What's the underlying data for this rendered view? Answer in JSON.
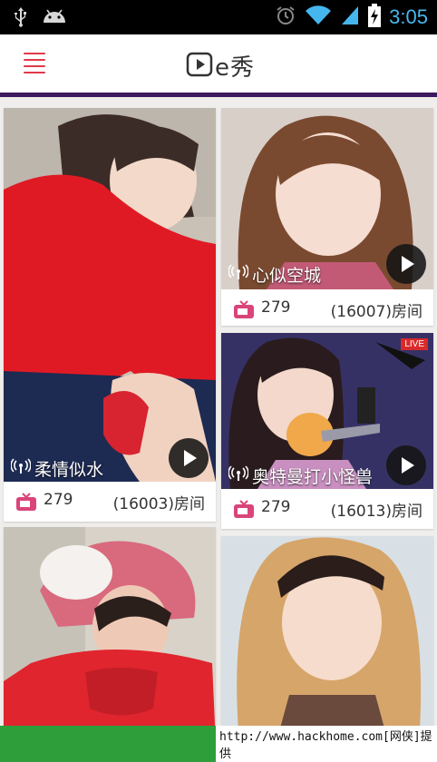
{
  "status_bar": {
    "time": "3:05",
    "icons": [
      "usb-icon",
      "android-icon",
      "alarm-icon",
      "wifi-icon",
      "signal-icon",
      "battery-charging-icon"
    ]
  },
  "app_bar": {
    "menu_icon": "hamburger-menu-icon",
    "logo_text": "e秀"
  },
  "rooms": [
    {
      "title": "柔情似水",
      "viewers": "279",
      "room": "(16003)房间"
    },
    {
      "title": "心似空城",
      "viewers": "279",
      "room": "(16007)房间"
    },
    {
      "title": "奥特曼打小怪兽",
      "viewers": "279",
      "room": "(16013)房间",
      "live_badge": "LIVE"
    },
    {
      "title": "",
      "viewers": "",
      "room": ""
    },
    {
      "title": "",
      "viewers": "",
      "room": ""
    }
  ],
  "watermark": "http://www.hackhome.com[网侠]提供",
  "colors": {
    "accent": "#e0394a",
    "app_bar_divider": "#3c1a5e",
    "status_bar": "#000000",
    "frame": "#2e9e3a"
  }
}
